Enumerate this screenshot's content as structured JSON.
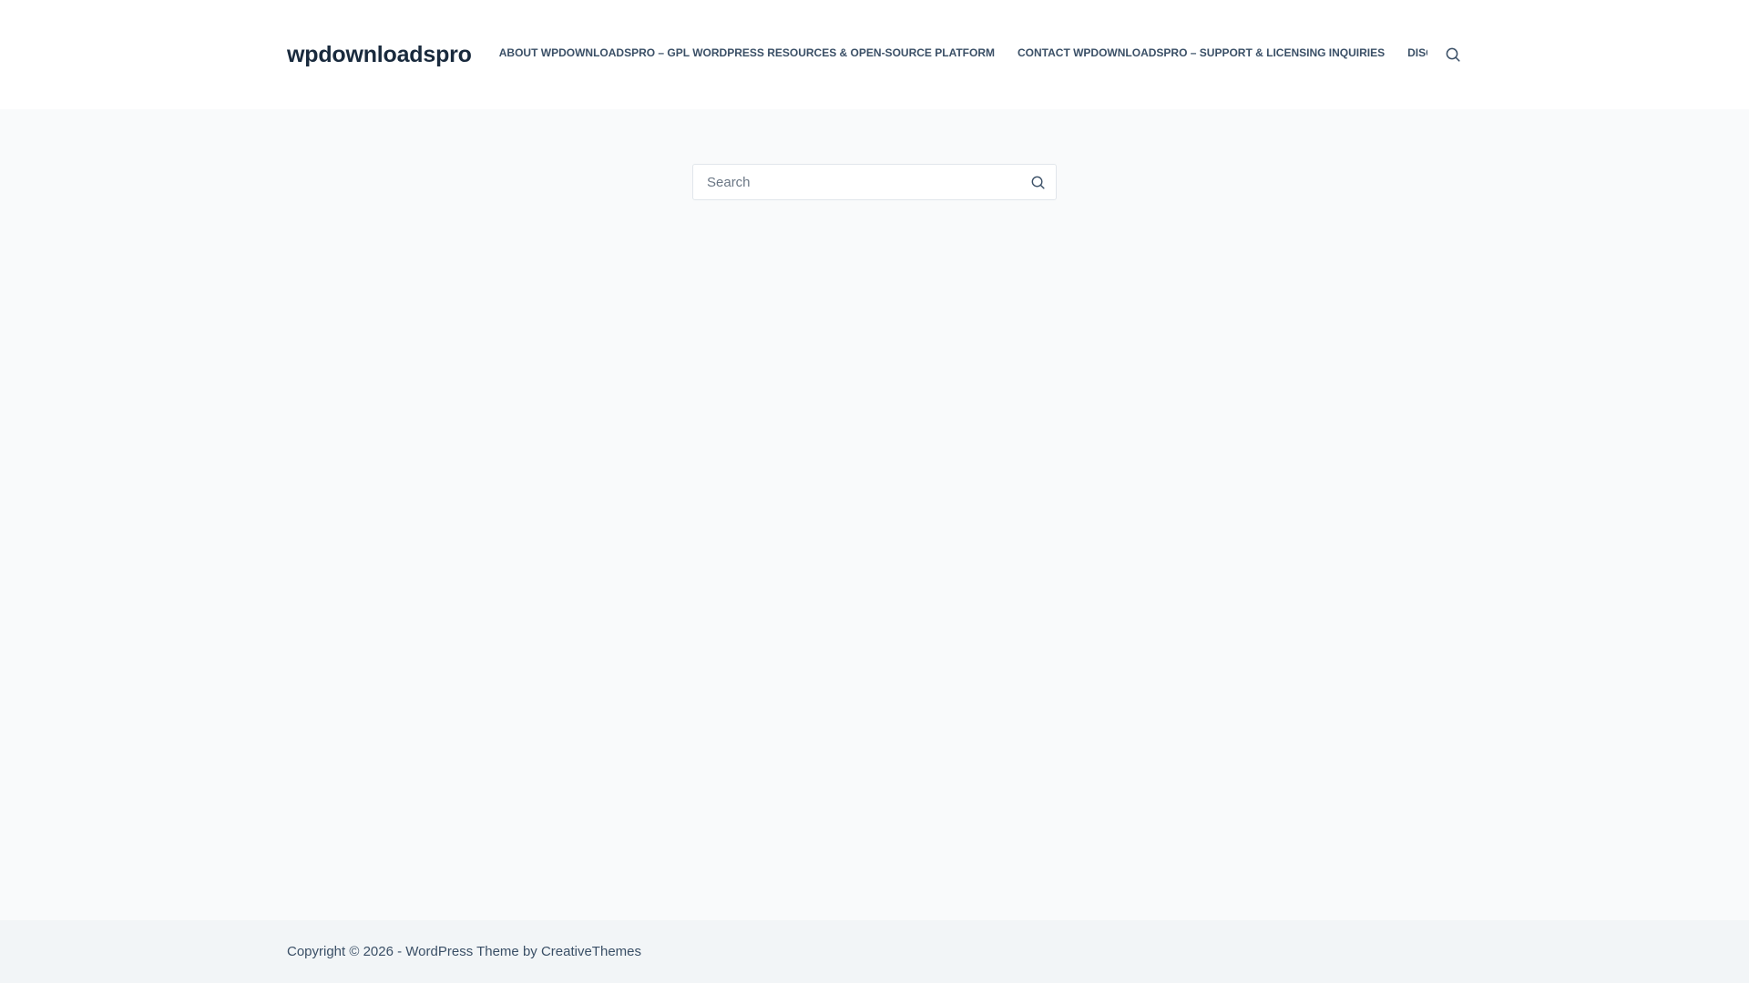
{
  "header": {
    "site_title": "wpdownloadspro",
    "nav": [
      {
        "label": "About wpdownloadspro – GPL WordPress Resources & Open-Source Platform"
      },
      {
        "label": "Contact wpdownloadspro – Support & Licensing Inquiries"
      },
      {
        "label": "Disclaimer – wpdownloadspro"
      }
    ],
    "search_icon": "search-icon"
  },
  "main": {
    "search": {
      "placeholder": "Search",
      "value": "",
      "submit_icon": "search-icon"
    }
  },
  "footer": {
    "copyright_prefix": "Copyright © 2026 - WordPress Theme by ",
    "theme_author": "CreativeThemes"
  },
  "colors": {
    "page_background": "#f9fafb",
    "header_background": "#ffffff",
    "footer_background": "#f2f5f7",
    "title_color": "#192a3d",
    "text_color": "#3a4f66",
    "input_border": "#e1e6eb"
  }
}
